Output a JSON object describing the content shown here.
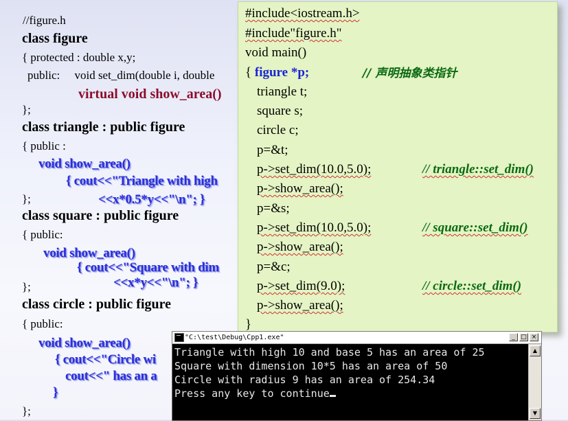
{
  "left": {
    "l1": "//figure.h",
    "l2": "class figure",
    "l3": "{ protected : double x,y;",
    "l4": "public:     void set_dim(double i, double",
    "l5": "virtual void show_area()",
    "l6": "};",
    "l7": "class triangle : public figure",
    "l8": "{ public :",
    "l9": "void show_area()",
    "l10": "{ cout<<\"Triangle with high",
    "l11": "};",
    "l12": "<<x*0.5*y<<\"\\n\"; }",
    "l13": "class square : public figure",
    "l14": "{ public:",
    "l15": "void show_area()",
    "l16": "{ cout<<\"Square with dim",
    "l17": "};",
    "l18": "<<x*y<<\"\\n\"; }",
    "l19": "class circle : public figure",
    "l20": "{ public:",
    "l21": "void show_area()",
    "l22": "{ cout<<\"Circle wi",
    "l23": "cout<<\" has an a",
    "l24": "}",
    "l25": "};"
  },
  "panel": {
    "p1": "#include<iostream.h>",
    "p2": "#include\"figure.h\"",
    "p3": "void main()",
    "p4a": "{ ",
    "p4b": "figure *p;",
    "p4c": "// 声明抽象类指针",
    "p5": "triangle t;",
    "p6": "square s;",
    "p7": "circle c;",
    "p8": "p=&t;",
    "p9": "p->set_dim(10.0,5.0);",
    "p9c": "// triangle::set_dim()",
    "p10": "p->show_area();",
    "p11": "p=&s;",
    "p12": "p->set_dim(10.0,5.0);",
    "p12c": "// square::set_dim()",
    "p13": "p->show_area();",
    "p14": "p=&c;",
    "p15": "p->set_dim(9.0);",
    "p15c": "// circle::set_dim()",
    "p16": "p->show_area();",
    "p17": "}"
  },
  "console": {
    "title": "\"C:\\test\\Debug\\Cpp1.exe\"",
    "minimize": "_",
    "maximize": "□",
    "close": "×",
    "lines": [
      "Triangle with high 10 and base 5 has an area of 25",
      "Square with dimension 10*5 has an area of 50",
      "Circle with radius 9 has an area of 254.34",
      "Press any key to continue"
    ],
    "scroll_up": "▲",
    "scroll_down": "▼"
  }
}
